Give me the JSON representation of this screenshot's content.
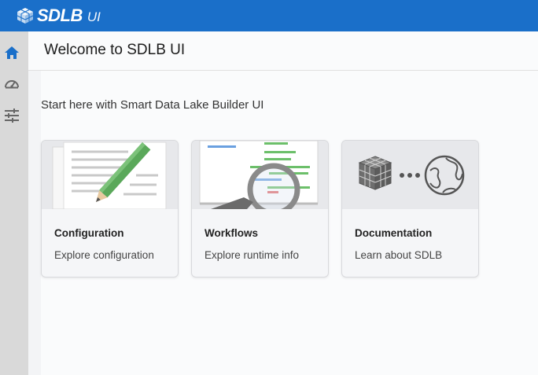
{
  "app": {
    "name": "SDLB",
    "suffix": "UI"
  },
  "sidebar": {
    "items": [
      {
        "icon": "home-icon",
        "active": true
      },
      {
        "icon": "dashboard-gauge-icon",
        "active": false
      },
      {
        "icon": "sliders-icon",
        "active": false
      }
    ]
  },
  "page": {
    "title": "Welcome to SDLB UI",
    "intro": "Start here with Smart Data Lake Builder UI"
  },
  "cards": [
    {
      "title": "Configuration",
      "description": "Explore configuration"
    },
    {
      "title": "Workflows",
      "description": "Explore runtime info"
    },
    {
      "title": "Documentation",
      "description": "Learn about SDLB"
    }
  ],
  "colors": {
    "brand": "#1a6fc9",
    "sidebar": "#d9d9d9",
    "active_icon": "#1a6fc9"
  }
}
